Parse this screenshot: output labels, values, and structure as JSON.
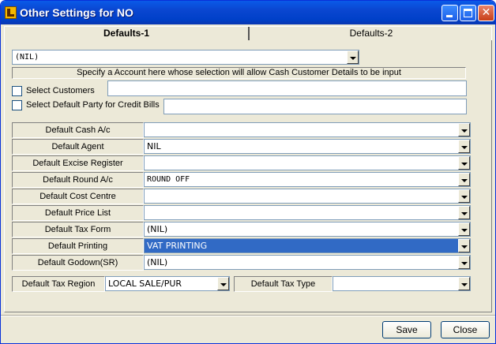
{
  "window": {
    "title": "Other Settings for NO"
  },
  "tabs": [
    {
      "label": "Defaults-1"
    },
    {
      "label": "Defaults-2"
    }
  ],
  "account_select": {
    "value": "(NIL)"
  },
  "info_text": "Specify a Account here whose selection will allow Cash Customer Details to be input",
  "checks": {
    "select_customers": "Select Customers",
    "default_party": "Select Default Party for Credit Bills"
  },
  "fields": [
    {
      "label": "Default Cash A/c",
      "value": ""
    },
    {
      "label": "Default Agent",
      "value": "NIL"
    },
    {
      "label": "Default Excise Register",
      "value": ""
    },
    {
      "label": "Default Round A/c",
      "value": "ROUND OFF"
    },
    {
      "label": "Default Cost Centre",
      "value": ""
    },
    {
      "label": "Default Price List",
      "value": ""
    },
    {
      "label": "Default Tax Form",
      "value": "(NIL)"
    },
    {
      "label": "Default Printing",
      "value": "VAT PRINTING"
    },
    {
      "label": "Default Godown(SR)",
      "value": "(NIL)"
    }
  ],
  "tax_region": {
    "label": "Default Tax Region",
    "value": "LOCAL SALE/PUR"
  },
  "tax_type": {
    "label": "Default Tax Type",
    "value": ""
  },
  "buttons": {
    "save": "Save",
    "close": "Close"
  },
  "icons": {
    "app": "tally-app-icon",
    "minimize": "minimize-icon",
    "maximize": "maximize-icon",
    "close": "close-icon",
    "dropdown": "chevron-down-icon"
  },
  "colors": {
    "titlebar": "#0a46d0",
    "selection": "#316ac5",
    "face": "#ece9d8"
  }
}
